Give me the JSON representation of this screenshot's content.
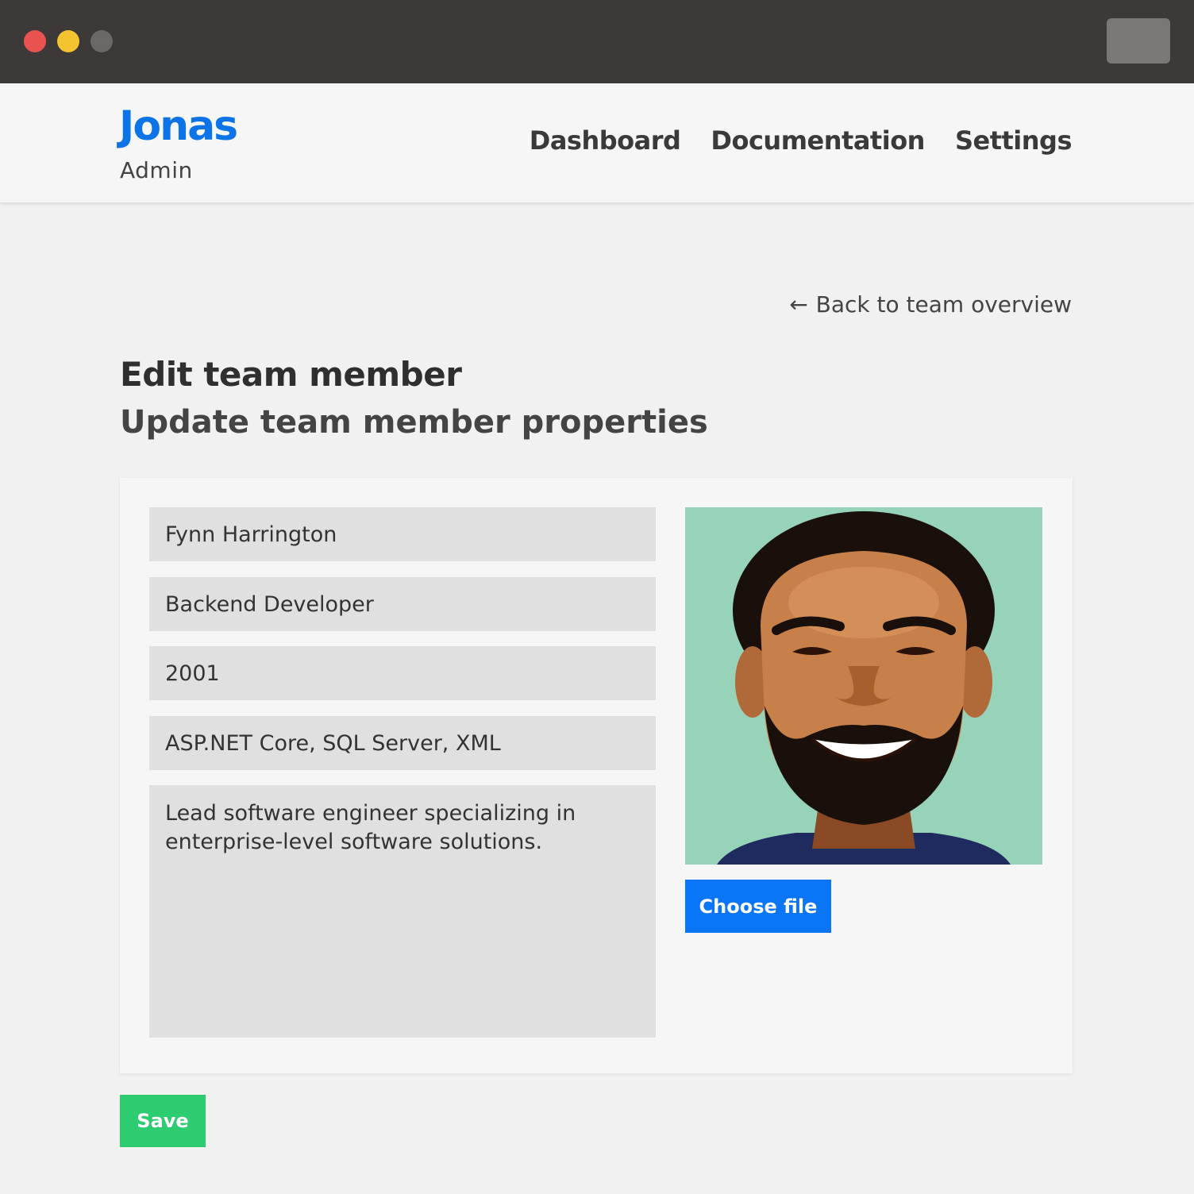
{
  "window": {
    "controls": [
      "close",
      "minimize",
      "zoom"
    ]
  },
  "header": {
    "brand": "Jonas",
    "brand_subtitle": "Admin",
    "nav": [
      "Dashboard",
      "Documentation",
      "Settings"
    ]
  },
  "page": {
    "back_link": "Back to team overview",
    "back_icon": "arrow-left-icon",
    "title": "Edit team member",
    "subtitle": "Update team member properties"
  },
  "form": {
    "name": "Fynn Harrington",
    "role": "Backend Developer",
    "year": "2001",
    "skills": "ASP.NET Core, SQL Server, XML",
    "bio": "Lead software engineer specializing in enterprise-level software solutions.",
    "choose_file_label": "Choose file",
    "save_label": "Save"
  },
  "colors": {
    "brand": "#0d74e8",
    "primary_button": "#0a76f6",
    "save_button": "#2ecc71",
    "photo_background": "#97d3b8"
  }
}
